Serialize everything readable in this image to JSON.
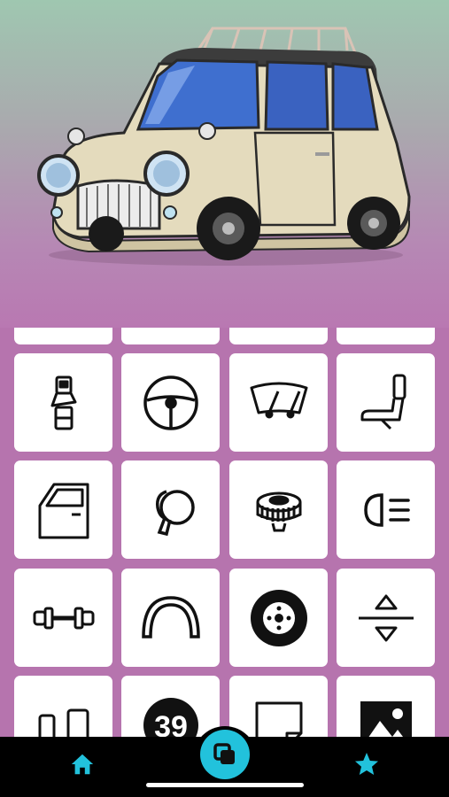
{
  "hero": {
    "illustration": "classic-mini-car"
  },
  "grid": {
    "rows": [
      [
        "seatbelt-icon",
        "steering-wheel-icon",
        "windshield-wiper-icon",
        "car-seat-icon"
      ],
      [
        "car-door-icon",
        "side-mirror-icon",
        "fuel-cap-icon",
        "headlight-icon"
      ],
      [
        "axle-icon",
        "wheel-arch-icon",
        "tire-icon",
        "suspension-height-icon"
      ],
      [
        "interior-icon",
        "race-number-icon",
        "sticker-icon",
        "photo-icon"
      ]
    ],
    "race_number": "39"
  },
  "tabbar": {
    "items": [
      "home-icon",
      "layers-icon",
      "star-icon"
    ],
    "accent": "#22c2dc"
  },
  "colors": {
    "background": "#b674ae",
    "tile": "#ffffff",
    "icon": "#111111"
  }
}
